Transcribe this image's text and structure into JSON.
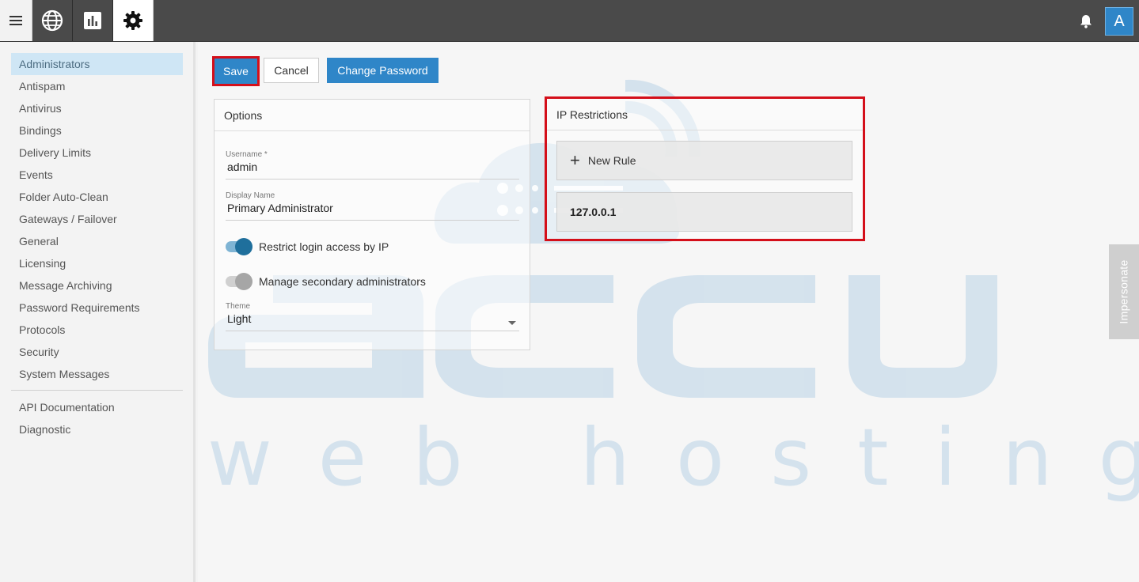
{
  "topbar": {
    "icons": {
      "menu": "hamburger-menu-icon",
      "globe": "globe-icon",
      "reports": "bar-chart-icon",
      "settings": "gear-icon",
      "notifications": "bell-icon"
    },
    "avatar_letter": "A",
    "colors": {
      "bar": "#4a4a4a",
      "accent": "#2f86c8"
    }
  },
  "sidebar": {
    "items": [
      {
        "label": "Administrators",
        "active": true
      },
      {
        "label": "Antispam"
      },
      {
        "label": "Antivirus"
      },
      {
        "label": "Bindings"
      },
      {
        "label": "Delivery Limits"
      },
      {
        "label": "Events"
      },
      {
        "label": "Folder Auto-Clean"
      },
      {
        "label": "Gateways / Failover"
      },
      {
        "label": "General"
      },
      {
        "label": "Licensing"
      },
      {
        "label": "Message Archiving"
      },
      {
        "label": "Password Requirements"
      },
      {
        "label": "Protocols"
      },
      {
        "label": "Security"
      },
      {
        "label": "System Messages"
      }
    ],
    "secondary": [
      {
        "label": "API Documentation"
      },
      {
        "label": "Diagnostic"
      }
    ]
  },
  "toolbar": {
    "save_label": "Save",
    "cancel_label": "Cancel",
    "change_password_label": "Change Password"
  },
  "options": {
    "title": "Options",
    "username": {
      "label": "Username *",
      "value": "admin"
    },
    "display_name": {
      "label": "Display Name",
      "value": "Primary Administrator"
    },
    "restrict_login": {
      "label": "Restrict login access by IP",
      "checked": true
    },
    "manage_secondary": {
      "label": "Manage secondary administrators",
      "checked": false
    },
    "theme": {
      "label": "Theme",
      "value": "Light"
    }
  },
  "ip_restrictions": {
    "title": "IP Restrictions",
    "new_rule_label": "New Rule",
    "rules": [
      "127.0.0.1"
    ]
  },
  "impersonate_label": "Impersonate",
  "watermark": {
    "logo_text": "accu",
    "tagline": "web hosting"
  },
  "highlight_color": "#d40f1a"
}
